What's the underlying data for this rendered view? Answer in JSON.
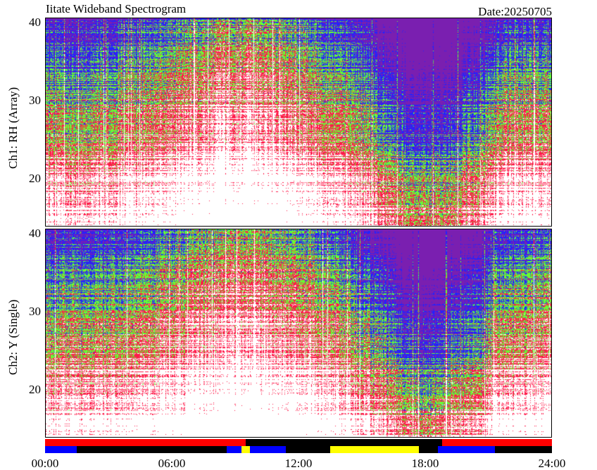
{
  "title": "Iitate Wideband Spectrogram",
  "date_label": "Date:20250705",
  "colors": {
    "background": "#ffffff",
    "low": "#7a1fb0",
    "blue": "#2222ff",
    "green": "#66ff33",
    "red": "#ff1a4a",
    "high": "#ffffff",
    "status_red": "#ff0000",
    "status_blue": "#0000ff",
    "status_yellow": "#ffff00",
    "status_black": "#000000"
  },
  "chart_data": [
    {
      "type": "heatmap",
      "title": "",
      "ylabel": "Ch1: RH (Array)",
      "xlabel": "",
      "ylim": [
        12,
        40.5
      ],
      "xlim": [
        "00:00",
        "24:00"
      ],
      "yticks": [
        "20",
        "30",
        "40"
      ],
      "xticks": [
        "00:00",
        "06:00",
        "12:00",
        "18:00",
        "24:00"
      ],
      "colormap": [
        "#7a1fb0",
        "#2222ff",
        "#66ff33",
        "#ff1a4a",
        "#ffffff"
      ]
    },
    {
      "type": "heatmap",
      "title": "",
      "ylabel": "Ch2: Y (Single)",
      "xlabel": "",
      "ylim": [
        12,
        40.5
      ],
      "xlim": [
        "00:00",
        "24:00"
      ],
      "yticks": [
        "20",
        "30",
        "40"
      ],
      "xticks": [
        "00:00",
        "06:00",
        "12:00",
        "18:00",
        "24:00"
      ],
      "colormap": [
        "#7a1fb0",
        "#2222ff",
        "#66ff33",
        "#ff1a4a",
        "#ffffff"
      ]
    }
  ],
  "status_bar": {
    "top_row": [
      {
        "start": 0.0,
        "end": 9.5,
        "color": "#ff0000"
      },
      {
        "start": 9.5,
        "end": 18.8,
        "color": "#000000"
      },
      {
        "start": 18.8,
        "end": 24.0,
        "color": "#ff0000"
      }
    ],
    "bottom_row": [
      {
        "start": 0.0,
        "end": 1.5,
        "color": "#0000ff"
      },
      {
        "start": 1.5,
        "end": 8.6,
        "color": "#000000"
      },
      {
        "start": 8.6,
        "end": 9.3,
        "color": "#0000ff"
      },
      {
        "start": 9.3,
        "end": 9.7,
        "color": "#ffff00"
      },
      {
        "start": 9.7,
        "end": 11.4,
        "color": "#0000ff"
      },
      {
        "start": 11.4,
        "end": 13.5,
        "color": "#000000"
      },
      {
        "start": 13.5,
        "end": 17.7,
        "color": "#ffff00"
      },
      {
        "start": 17.7,
        "end": 18.6,
        "color": "#000000"
      },
      {
        "start": 18.6,
        "end": 21.3,
        "color": "#0000ff"
      },
      {
        "start": 21.3,
        "end": 24.0,
        "color": "#000000"
      }
    ]
  }
}
